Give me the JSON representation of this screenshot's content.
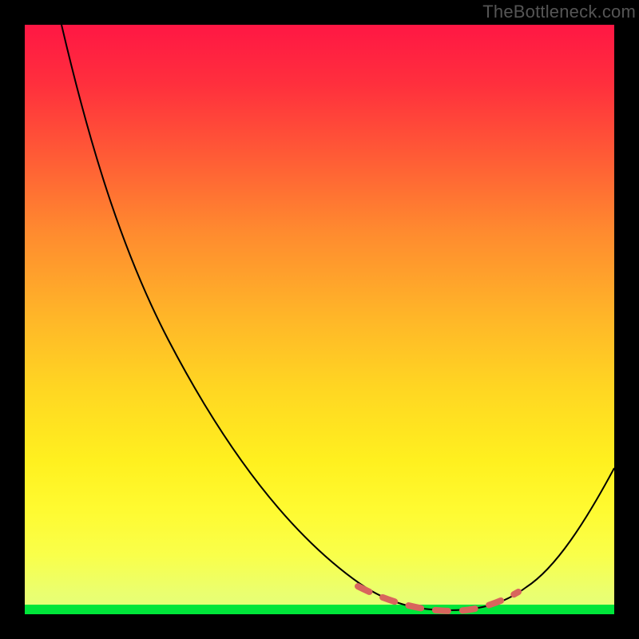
{
  "watermark": "TheBottleneck.com",
  "colors": {
    "background": "#000000",
    "gradient_top": "#ff1744",
    "gradient_mid": "#ffd722",
    "gradient_bottom": "#e3ff7a",
    "green_band": "#00e63a",
    "curve": "#000000",
    "dash": "#d8655d"
  },
  "chart_data": {
    "type": "line",
    "title": "",
    "xlabel": "",
    "ylabel": "",
    "xlim": [
      0,
      100
    ],
    "ylim": [
      0,
      100
    ],
    "series": [
      {
        "name": "bottleneck_curve",
        "x": [
          6,
          12,
          18,
          24,
          30,
          36,
          42,
          48,
          54,
          58,
          62,
          66,
          70,
          74,
          78,
          82,
          86,
          90,
          94,
          100
        ],
        "y": [
          100,
          88,
          76,
          65,
          55,
          46,
          38,
          30,
          22,
          16,
          11,
          7,
          4,
          2,
          1,
          1,
          3,
          7,
          14,
          25
        ]
      }
    ],
    "annotations": [
      {
        "name": "minimum_highlight",
        "style": "dashed",
        "x_range": [
          57,
          84
        ],
        "y_approx": 2
      },
      {
        "name": "green_zone",
        "y_range": [
          0,
          2
        ]
      }
    ]
  }
}
